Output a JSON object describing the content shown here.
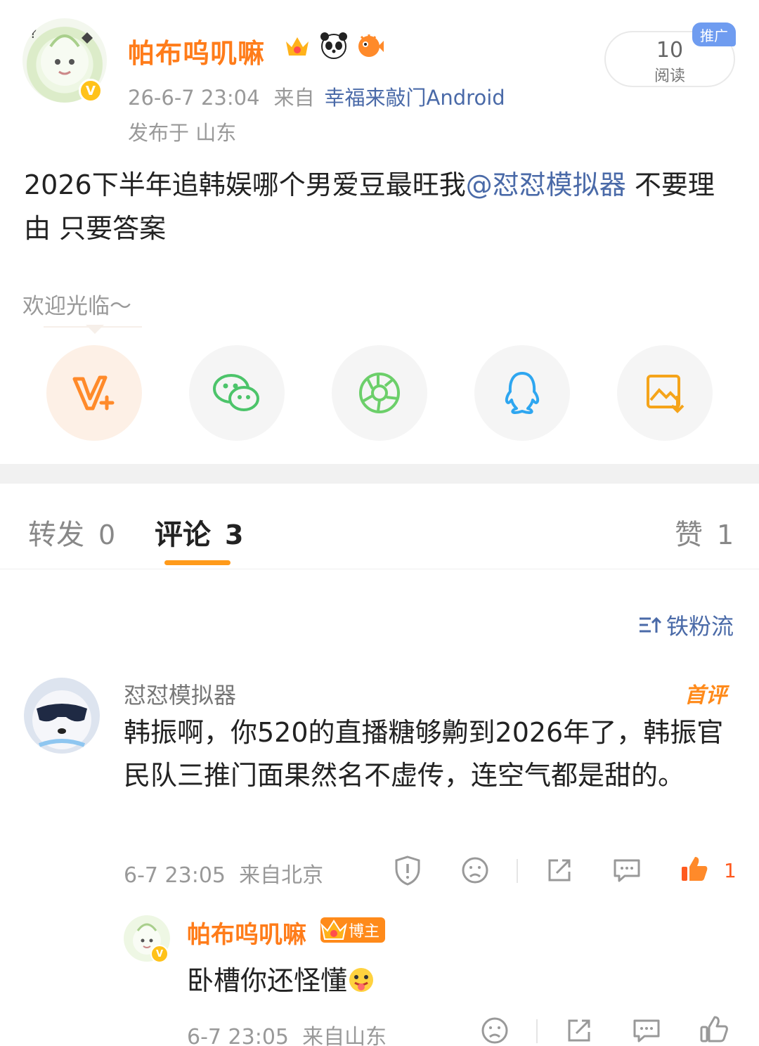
{
  "post": {
    "author": "帕布呜叽嘛",
    "timestamp": "26-6-7 23:04",
    "from_label": "来自",
    "source": "幸福来敲门Android",
    "location": "发布于 山东",
    "reads_count": "10",
    "reads_label": "阅读",
    "promo_label": "推广",
    "text_before_mention": "2026下半年追韩娱哪个男爱豆最旺我",
    "mention": "@怼怼模拟器",
    "text_after_mention": " 不要理由 只要答案"
  },
  "share": {
    "welcome": "欢迎光临～",
    "buttons": [
      "vplus-icon",
      "wechat-icon",
      "moments-icon",
      "qq-icon",
      "save-image-icon"
    ]
  },
  "tabs": {
    "repost_label": "转发",
    "repost_count": "0",
    "comment_label": "评论",
    "comment_count": "3",
    "like_label": "赞",
    "like_count": "1"
  },
  "sort_label": "铁粉流",
  "comment": {
    "author": "怼怼模拟器",
    "badge": "首评",
    "text": "韩振啊，你520的直播糖够齁到2026年了，韩振官民队三推门面果然名不虚传，连空气都是甜的。",
    "time": "6-7  23:05",
    "location": "来自北京",
    "like_count": "1"
  },
  "reply": {
    "author": "帕布呜叽嘛",
    "badge": "博主",
    "text": "卧槽你还怪懂",
    "time": "6-7  23:05",
    "location": "来自山东"
  },
  "colors": {
    "accent_orange": "#ff7c1a",
    "link_blue": "#4a6aa8",
    "like_red": "#ff5a1f"
  }
}
